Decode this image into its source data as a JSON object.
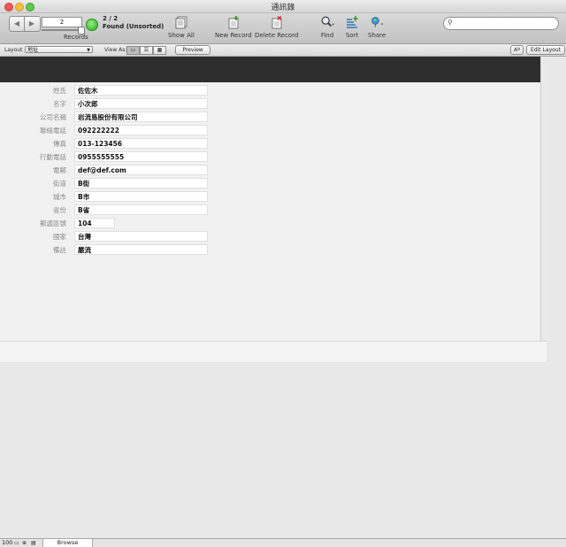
{
  "window": {
    "title": "通訊錄"
  },
  "toolbar": {
    "record_number": "2",
    "records_label": "Records",
    "count": "2 / 2",
    "found": "Found (Unsorted)",
    "show_all": "Show All",
    "new_record": "New Record",
    "delete_record": "Delete Record",
    "find": "Find",
    "sort": "Sort",
    "share": "Share",
    "search_placeholder": ""
  },
  "layoutbar": {
    "layout_label": "Layout",
    "layout_value": "地址",
    "view_as_label": "View As:",
    "preview": "Preview",
    "font_button": "Aª",
    "edit_layout": "Edit Layout"
  },
  "fields": [
    {
      "label": "姓氏",
      "value": "佐佐木"
    },
    {
      "label": "名字",
      "value": "小次郎"
    },
    {
      "label": "公司名稱",
      "value": "岩流島股份有限公司"
    },
    {
      "label": "聯絡電話",
      "value": "092222222"
    },
    {
      "label": "傳真",
      "value": "013-123456"
    },
    {
      "label": "行動電話",
      "value": "0955555555"
    },
    {
      "label": "電郵",
      "value": "def@def.com"
    },
    {
      "label": "街道",
      "value": "B街"
    },
    {
      "label": "城市",
      "value": "B市"
    },
    {
      "label": "省份",
      "value": "B省"
    },
    {
      "label": "郵遞區號",
      "value": "104"
    },
    {
      "label": "國家",
      "value": "台灣"
    },
    {
      "label": "備註",
      "value": "嚴流"
    }
  ],
  "statusbar": {
    "zoom": "100",
    "mode": "Browse"
  }
}
